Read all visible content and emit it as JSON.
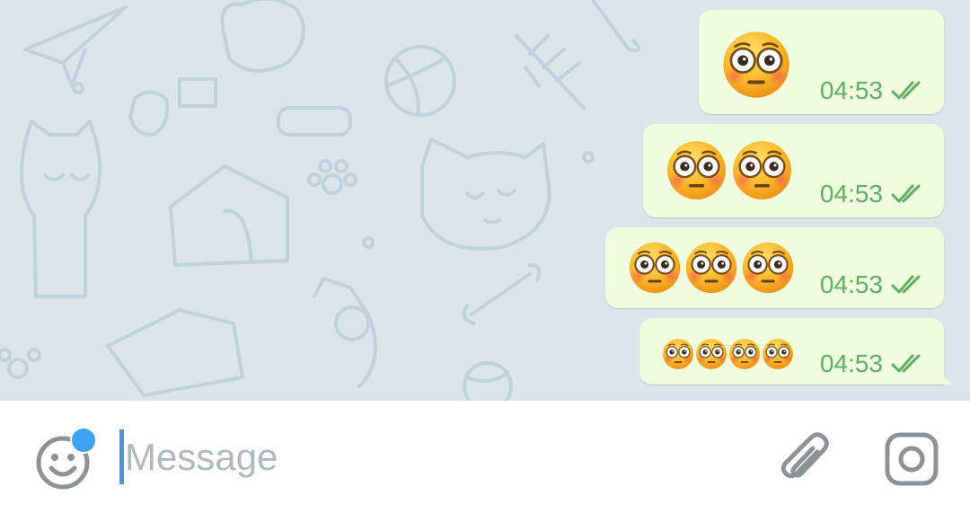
{
  "theme": {
    "chat_background": "#dce5ea",
    "doodle_color": "#c1d2dc",
    "outgoing_bubble": "#effdde",
    "meta_green": "#5fae63",
    "input_background": "#ffffff",
    "placeholder_color": "#b2b7bb",
    "accent_blue": "#3ea3f2",
    "icon_gray": "#8d9296"
  },
  "messages": [
    {
      "emoji": "😳",
      "emoji_name": "flushed-face",
      "count": 1,
      "time": "04:53",
      "status": "read",
      "status_icon": "double-check-icon"
    },
    {
      "emoji": "😳😳",
      "emoji_name": "flushed-face",
      "count": 2,
      "time": "04:53",
      "status": "read",
      "status_icon": "double-check-icon"
    },
    {
      "emoji": "😳😳😳",
      "emoji_name": "flushed-face",
      "count": 3,
      "time": "04:53",
      "status": "read",
      "status_icon": "double-check-icon"
    },
    {
      "emoji": "😳😳😳😳",
      "emoji_name": "flushed-face",
      "count": 4,
      "time": "04:53",
      "status": "read",
      "status_icon": "double-check-icon"
    }
  ],
  "input": {
    "placeholder": "Message",
    "value": "",
    "emoji_button_icon": "smiley-icon",
    "emoji_button_has_notification": true,
    "attach_icon": "paperclip-icon",
    "camera_icon": "camera-icon"
  }
}
